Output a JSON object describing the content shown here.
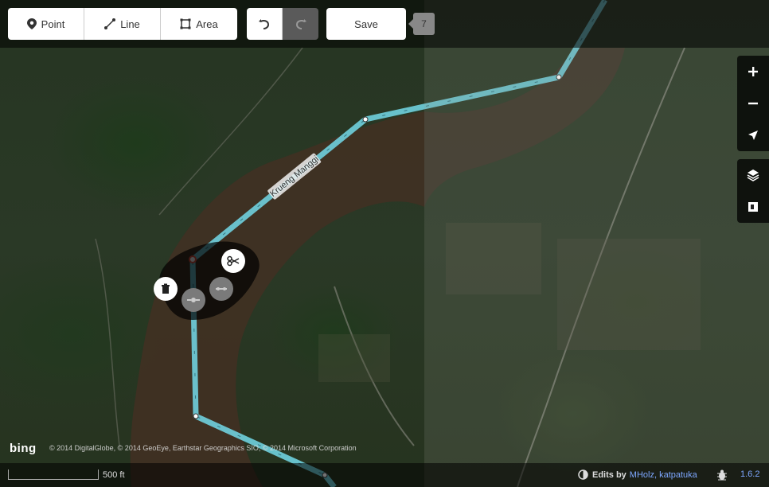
{
  "toolbar": {
    "point_label": "Point",
    "line_label": "Line",
    "area_label": "Area",
    "save_label": "Save",
    "edit_count": "7"
  },
  "map": {
    "waterway_name": "Krueng Manggi",
    "attribution": "© 2014 DigitalGlobe, © 2014 GeoEye, Earthstar Geographics SIO, © 2014 Microsoft Corporation",
    "imagery_logo": "bing"
  },
  "footer": {
    "scale_label": "500 ft",
    "edits_label": "Edits by",
    "editors": "MHolz, katpatuka",
    "version": "1.6.2"
  },
  "icons": {
    "point": "map-pin-icon",
    "line": "line-icon",
    "area": "area-icon",
    "undo": "undo-icon",
    "redo": "redo-icon",
    "zoom_in": "plus-icon",
    "zoom_out": "minus-icon",
    "geolocate": "location-arrow-icon",
    "background": "layers-icon",
    "map_data": "map-data-icon",
    "delete": "trash-icon",
    "split": "scissors-icon"
  },
  "colors": {
    "selected_way": "#6fd0de",
    "link": "#7ea7ff"
  }
}
